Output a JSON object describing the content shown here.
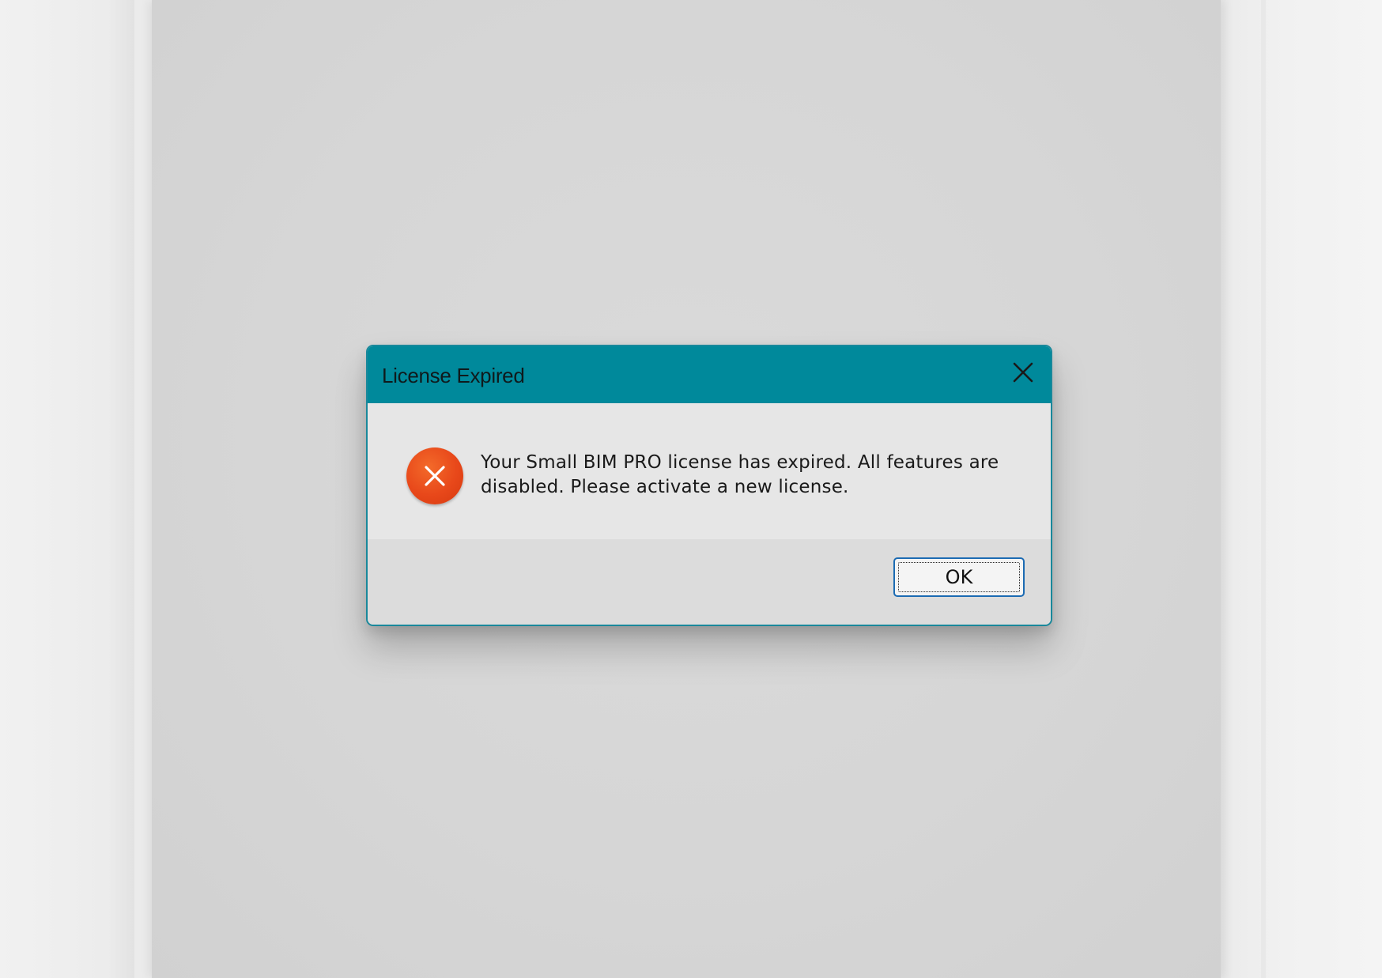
{
  "dialog": {
    "title": "License Expired",
    "message_line1": "Your Small BIM PRO license has expired. All features are",
    "message_line2": "disabled. Please activate a new license.",
    "ok_label": "OK",
    "icons": {
      "error": "error-x-icon",
      "close": "close-icon"
    }
  },
  "colors": {
    "titlebar": "#00899b",
    "error_icon": "#e8481a",
    "button_border": "#1c6bb3"
  }
}
